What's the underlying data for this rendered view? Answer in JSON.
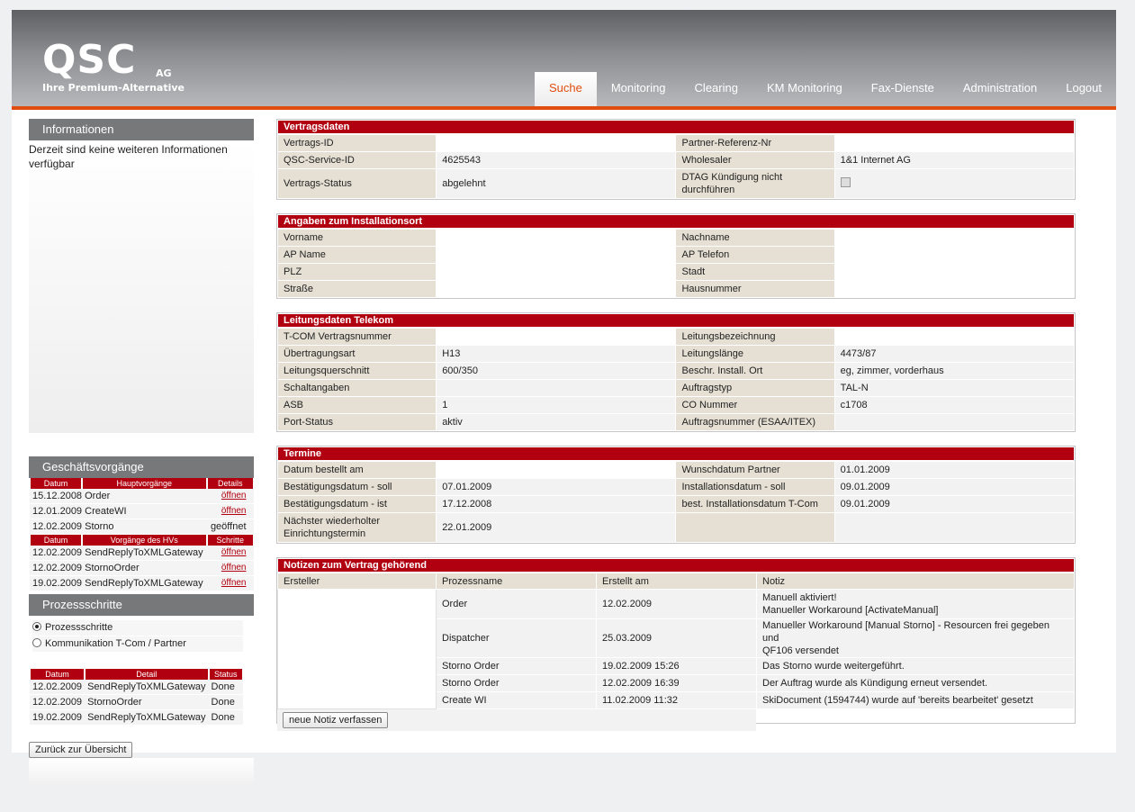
{
  "header": {
    "logo_main": "QSC",
    "logo_ag": "AG",
    "logo_sub": "Ihre Premium-Alternative",
    "nav": [
      "Suche",
      "Monitoring",
      "Clearing",
      "KM Monitoring",
      "Fax-Dienste",
      "Administration",
      "Logout"
    ],
    "active_nav": "Suche"
  },
  "sidebar": {
    "info_title": "Informationen",
    "info_text": "Derzeit sind keine weiteren Informationen verfügbar",
    "gv_title": "Geschäftsvorgänge",
    "gv_headers": [
      "Datum",
      "Hauptvorgänge",
      "Details"
    ],
    "gv_rows": [
      {
        "date": "15.12.2008",
        "name": "Order",
        "detail": "öffnen"
      },
      {
        "date": "12.01.2009",
        "name": "CreateWI",
        "detail": "öffnen"
      },
      {
        "date": "12.02.2009",
        "name": "Storno",
        "detail": "geöffnet"
      }
    ],
    "hv_headers": [
      "Datum",
      "Vorgänge des HVs",
      "Schritte"
    ],
    "hv_rows": [
      {
        "date": "12.02.2009",
        "name": "SendReplyToXMLGateway",
        "detail": "öffnen"
      },
      {
        "date": "12.02.2009",
        "name": "StornoOrder",
        "detail": "öffnen"
      },
      {
        "date": "19.02.2009",
        "name": "SendReplyToXMLGateway",
        "detail": "öffnen"
      }
    ],
    "ps_title": "Prozessschritte",
    "ps_options": [
      "Prozessschritte",
      "Kommunikation T-Com / Partner"
    ],
    "ps_headers": [
      "Datum",
      "Detail",
      "Status"
    ],
    "ps_rows": [
      {
        "date": "12.02.2009",
        "detail": "SendReplyToXMLGateway",
        "status": "Done"
      },
      {
        "date": "12.02.2009",
        "detail": "StornoOrder",
        "status": "Done"
      },
      {
        "date": "19.02.2009",
        "detail": "SendReplyToXMLGateway",
        "status": "Done"
      }
    ],
    "back_button": "Zurück zur Übersicht"
  },
  "vertragsdaten": {
    "title": "Vertragsdaten",
    "rows": [
      [
        "Vertrags-ID",
        "",
        "Partner-Referenz-Nr",
        ""
      ],
      [
        "QSC-Service-ID",
        "4625543",
        "Wholesaler",
        "1&1 Internet AG"
      ],
      [
        "Vertrags-Status",
        "abgelehnt",
        "DTAG Kündigung nicht durchführen",
        ""
      ]
    ]
  },
  "installationsort": {
    "title": "Angaben zum Installationsort",
    "rows": [
      [
        "Vorname",
        "",
        "Nachname",
        ""
      ],
      [
        "AP Name",
        "",
        "AP Telefon",
        ""
      ],
      [
        "PLZ",
        "",
        "Stadt",
        ""
      ],
      [
        "Straße",
        "",
        "Hausnummer",
        ""
      ]
    ]
  },
  "leitungsdaten": {
    "title": "Leitungsdaten Telekom",
    "rows": [
      [
        "T-COM Vertragsnummer",
        "",
        "Leitungsbezeichnung",
        ""
      ],
      [
        "Übertragungsart",
        "H13",
        "Leitungslänge",
        "4473/87"
      ],
      [
        "Leitungsquerschnitt",
        "600/350",
        "Beschr. Install. Ort",
        "eg, zimmer, vorderhaus"
      ],
      [
        "Schaltangaben",
        "",
        "Auftragstyp",
        "TAL-N"
      ],
      [
        "ASB",
        "1",
        "CO Nummer",
        "c1708"
      ],
      [
        "Port-Status",
        "aktiv",
        "Auftragsnummer (ESAA/ITEX)",
        ""
      ]
    ]
  },
  "termine": {
    "title": "Termine",
    "rows": [
      [
        "Datum bestellt am",
        "",
        "Wunschdatum Partner",
        "01.01.2009"
      ],
      [
        "Bestätigungsdatum - soll",
        "07.01.2009",
        "Installationsdatum - soll",
        "09.01.2009"
      ],
      [
        "Bestätigungsdatum - ist",
        "17.12.2008",
        "best. Installationsdatum T-Com",
        "09.01.2009"
      ],
      [
        "Nächster wiederholter Einrichtungstermin",
        "22.01.2009",
        "",
        ""
      ]
    ]
  },
  "notizen": {
    "title": "Notizen zum Vertrag gehörend",
    "headers": [
      "Ersteller",
      "Prozessname",
      "Erstellt am",
      "Notiz"
    ],
    "rows": [
      {
        "process": "Order",
        "date": "12.02.2009",
        "note": "Manuell aktiviert!",
        "note2": "Manueller Workaround [ActivateManual]"
      },
      {
        "process": "Dispatcher",
        "date": "25.03.2009",
        "note": "Manueller Workaround [Manual Storno] - Resourcen frei gegeben und",
        "note2": "QF106 versendet"
      },
      {
        "process": "Storno Order",
        "date": "19.02.2009 15:26",
        "note": "Das Storno wurde weitergeführt.",
        "note2": ""
      },
      {
        "process": "Storno Order",
        "date": "12.02.2009 16:39",
        "note": "Der Auftrag wurde als Kündigung erneut versendet.",
        "note2": ""
      },
      {
        "process": "Create WI",
        "date": "11.02.2009 11:32",
        "note": "SkiDocument (1594744) wurde auf 'bereits bearbeitet' gesetzt",
        "note2": ""
      }
    ],
    "button": "neue Notiz verfassen"
  }
}
